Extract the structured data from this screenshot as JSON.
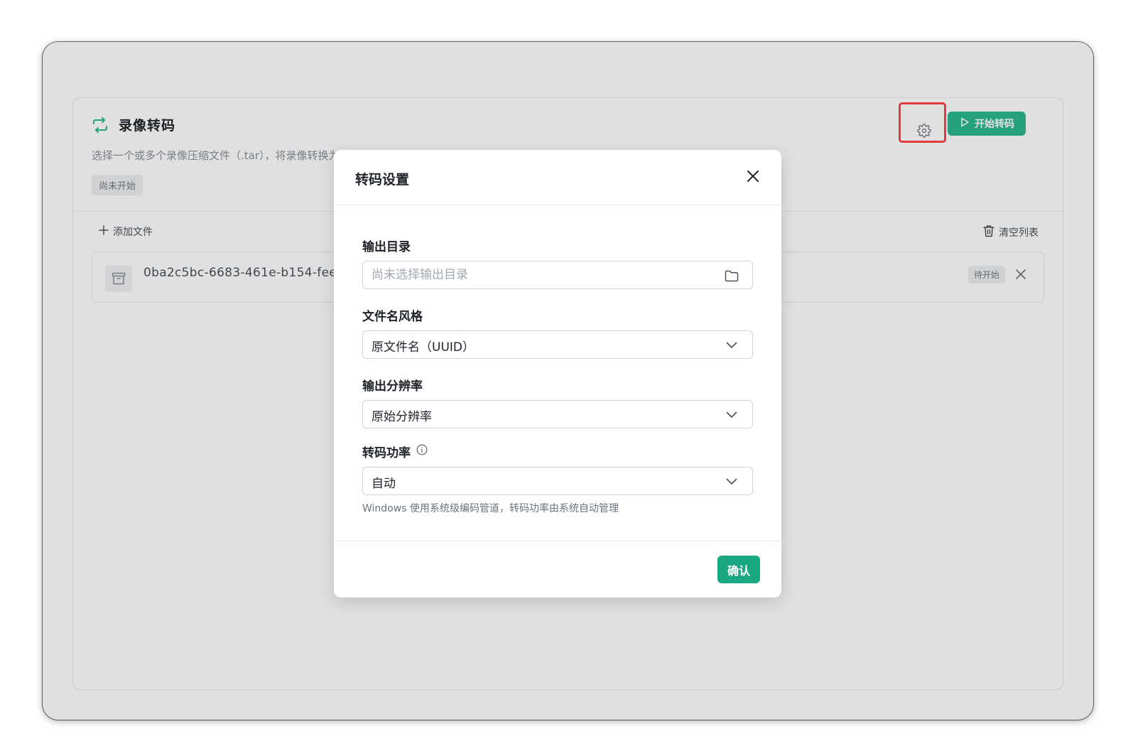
{
  "app": {
    "title": "录像转码",
    "description": "选择一个或多个录像压缩文件（.tar），将录像转换为 … 格式",
    "status_tag": "尚未开始",
    "start_button": "开始转码",
    "add_file": "添加文件",
    "clear_list": "清空列表",
    "files": [
      {
        "name": "0ba2c5bc-6683-461e-b154-fee9",
        "status": "待开始"
      }
    ]
  },
  "modal": {
    "title": "转码设置",
    "output_dir": {
      "label": "输出目录",
      "placeholder": "尚未选择输出目录"
    },
    "filename_style": {
      "label": "文件名风格",
      "value": "原文件名（UUID）"
    },
    "resolution": {
      "label": "输出分辨率",
      "value": "原始分辨率"
    },
    "power": {
      "label": "转码功率",
      "value": "自动",
      "hint": "Windows 使用系统级编码管道，转码功率由系统自动管理"
    },
    "confirm_button": "确认"
  },
  "colors": {
    "accent": "#1aa784",
    "highlight": "#e23b3b"
  },
  "icons": {
    "title": "repeat-icon",
    "settings": "gear-icon",
    "start": "play-icon",
    "add": "plus-icon",
    "clear": "trash-icon",
    "file": "archive-icon",
    "remove": "close-icon",
    "folder": "folder-icon",
    "dropdown": "chevron-down-icon",
    "info": "info-icon"
  }
}
